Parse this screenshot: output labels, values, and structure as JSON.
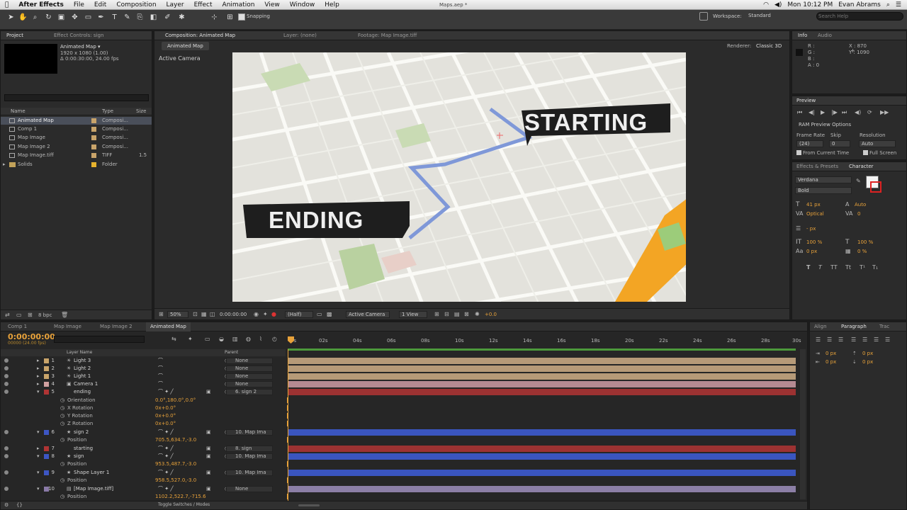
{
  "menubar": {
    "app": "After Effects",
    "items": [
      "File",
      "Edit",
      "Composition",
      "Layer",
      "Effect",
      "Animation",
      "View",
      "Window",
      "Help"
    ],
    "doc_title": "Maps.aep *",
    "clock": "Mon 10:12 PM",
    "user": "Evan Abrams"
  },
  "toolbar": {
    "snapping": "Snapping",
    "workspace_label": "Workspace:",
    "workspace_value": "Standard",
    "search_placeholder": "Search Help"
  },
  "project": {
    "tab": "Project",
    "tab2": "Effect Controls: sign",
    "comp_name": "Animated Map ▾",
    "comp_info1": "1920 x 1080 (1.00)",
    "comp_info2": "Δ 0:00:30:00, 24.00 fps",
    "col_name": "Name",
    "col_type": "Type",
    "col_size": "Size",
    "items": [
      {
        "name": "Animated Map",
        "type": "Composi...",
        "size": "",
        "color": "#c9a46a"
      },
      {
        "name": "Comp 1",
        "type": "Composi...",
        "size": "",
        "color": "#c9a46a"
      },
      {
        "name": "Map Image",
        "type": "Composi...",
        "size": "",
        "color": "#c9a46a"
      },
      {
        "name": "Map Image 2",
        "type": "Composi...",
        "size": "",
        "color": "#c9a46a"
      },
      {
        "name": "Map Image.tiff",
        "type": "TIFF",
        "size": "1.5",
        "color": "#c9a46a"
      },
      {
        "name": "Solids",
        "type": "Folder",
        "size": "",
        "color": "#e6b22d"
      }
    ],
    "bpc": "8 bpc"
  },
  "composition": {
    "tab": "Composition: Animated Map",
    "tab_layer": "Layer: (none)",
    "tab_footage": "Footage: Map Image.tiff",
    "subtab": "Animated Map",
    "renderer_label": "Renderer:",
    "renderer_value": "Classic 3D",
    "active_camera": "Active Camera",
    "starting_text": "STARTING",
    "ending_text": "ENDING",
    "footer": {
      "zoom": "50%",
      "timecode": "0:00:00:00",
      "resolution": "(Half)",
      "camera": "Active Camera",
      "views": "1 View",
      "exposure": "+0.0"
    }
  },
  "info": {
    "tab": "Info",
    "tab2": "Audio",
    "r": "R :",
    "g": "G :",
    "b": "B :",
    "a": "A : 0",
    "x": "X : 870",
    "y": "Y : 1090"
  },
  "preview": {
    "tab": "Preview",
    "ram": "RAM Preview Options",
    "frame_rate_label": "Frame Rate",
    "skip_label": "Skip",
    "resolution_label": "Resolution",
    "frame_rate": "(24)",
    "skip": "0",
    "resolution": "Auto",
    "from_current": "From Current Time",
    "full_screen": "Full Screen"
  },
  "character": {
    "tab1": "Effects & Presets",
    "tab2": "Character",
    "font": "Verdana",
    "style": "Bold",
    "size": "41 px",
    "leading": "Auto",
    "kerning": "Optical",
    "tracking": "0",
    "stroke": "- px",
    "vscale": "100 %",
    "hscale": "100 %",
    "baseline": "0 px",
    "tsume": "0 %"
  },
  "paragraph": {
    "tab1": "Align",
    "tab2": "Paragraph",
    "tab3": "Trac",
    "v1": "0 px",
    "v2": "0 px",
    "v3": "0 px",
    "v4": "0 px"
  },
  "timeline": {
    "tabs": [
      "Comp 1",
      "Map Image",
      "Map Image 2",
      "Animated Map"
    ],
    "active_tab": "Animated Map",
    "timecode": "0:00:00:00",
    "fps": "00000 (24.00 fps)",
    "col_layer": "Layer Name",
    "col_parent": "Parent",
    "ruler": [
      "0s",
      "02s",
      "04s",
      "06s",
      "08s",
      "10s",
      "12s",
      "14s",
      "16s",
      "18s",
      "20s",
      "22s",
      "24s",
      "26s",
      "28s",
      "30s"
    ],
    "toggle": "Toggle Switches / Modes",
    "layers": [
      {
        "num": "1",
        "name": "Light 3",
        "parent": "None",
        "color": "#c9a46a",
        "bar": "#b69a78"
      },
      {
        "num": "2",
        "name": "Light 2",
        "parent": "None",
        "color": "#c9a46a",
        "bar": "#b69a78"
      },
      {
        "num": "3",
        "name": "Light 1",
        "parent": "None",
        "color": "#c9a46a",
        "bar": "#b69a78"
      },
      {
        "num": "4",
        "name": "Camera 1",
        "parent": "None",
        "color": "#d0a0a0",
        "bar": "#b58a92"
      },
      {
        "num": "5",
        "name": "ending",
        "parent": "6. sign 2",
        "color": "#b03434",
        "bar": "#9c3232"
      },
      {
        "num": "6",
        "name": "sign 2",
        "parent": "10. Map Ima",
        "color": "#3d56c4",
        "bar": "#3a55bf"
      },
      {
        "num": "7",
        "name": "starting",
        "parent": "8. sign",
        "color": "#b03434",
        "bar": "#9c3232"
      },
      {
        "num": "8",
        "name": "sign",
        "parent": "10. Map Ima",
        "color": "#3d56c4",
        "bar": "#3a55bf"
      },
      {
        "num": "9",
        "name": "Shape Layer 1",
        "parent": "10. Map Ima",
        "color": "#3d56c4",
        "bar": "#3a55bf"
      },
      {
        "num": "10",
        "name": "[Map Image.tiff]",
        "parent": "None",
        "color": "#8a7aa8",
        "bar": "#8c7fa6"
      }
    ],
    "props": {
      "orientation": {
        "label": "Orientation",
        "value": "0.0°,180.0°,0.0°"
      },
      "xrot": {
        "label": "X Rotation",
        "value": "0x+0.0°"
      },
      "yrot": {
        "label": "Y Rotation",
        "value": "0x+0.0°"
      },
      "zrot": {
        "label": "Z Rotation",
        "value": "0x+0.0°"
      },
      "pos6": {
        "label": "Position",
        "value": "705.5,634.7,-3.0"
      },
      "pos8": {
        "label": "Position",
        "value": "953.5,487.7,-3.0"
      },
      "pos9": {
        "label": "Position",
        "value": "958.5,527.0,-3.0"
      },
      "pos10": {
        "label": "Position",
        "value": "1102.2,522.7,-715.6"
      }
    }
  }
}
